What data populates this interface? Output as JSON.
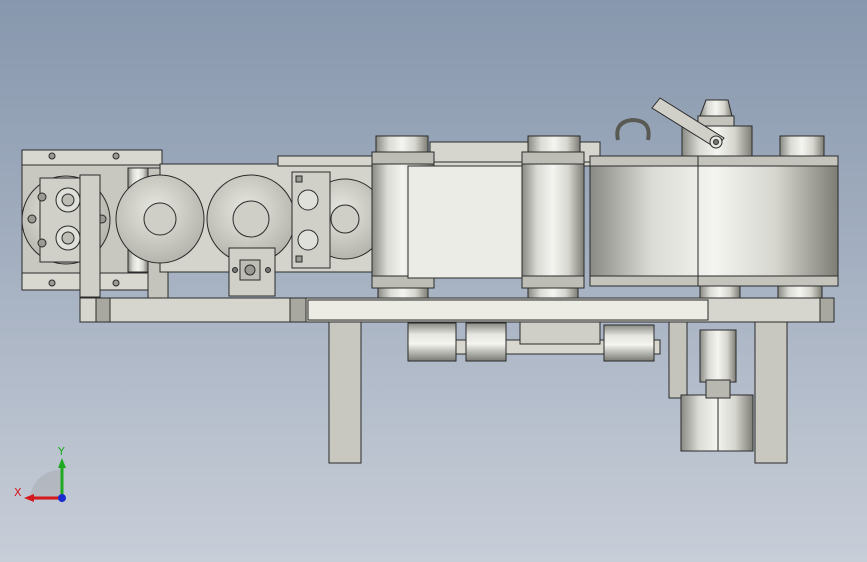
{
  "viewport": {
    "background_top": "#8797ad",
    "background_bottom": "#c8ced8"
  },
  "model": {
    "view": "front",
    "part_color": "#d4d4cc",
    "edge_color": "#2a2a2a"
  },
  "triad": {
    "x_label": "X",
    "y_label": "Y",
    "x_color": "#d4181c",
    "y_color": "#1faa22",
    "z_color": "#1a2ccf"
  }
}
